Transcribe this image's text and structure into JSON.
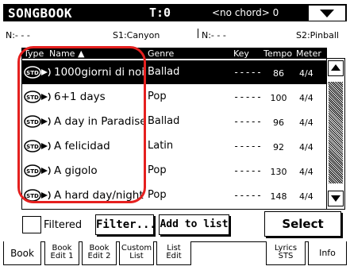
{
  "titlebar": {
    "title": "SONGBOOK",
    "tempo": "T:0",
    "chord": "<no chord> 0"
  },
  "splitrow": {
    "left_split": "N:- - -",
    "s1": "S1:Canyon",
    "mid_split": "N:- - -",
    "s2": "S2:Pinball"
  },
  "table": {
    "headers": {
      "type": "Type",
      "name": "Name ▲",
      "genre": "Genre",
      "key": "Key",
      "tempo": "Tempo",
      "meter": "Meter"
    },
    "rows": [
      {
        "name": "1000giorni di noi",
        "genre": "Ballad",
        "key": "-----",
        "tempo": "86",
        "meter": "4/4",
        "selected": true
      },
      {
        "name": "6+1 days",
        "genre": "Pop",
        "key": "-----",
        "tempo": "100",
        "meter": "4/4",
        "selected": false
      },
      {
        "name": "A day in Paradise",
        "genre": "Ballad",
        "key": "-----",
        "tempo": "96",
        "meter": "4/4",
        "selected": false
      },
      {
        "name": "A felicidad",
        "genre": "Latin",
        "key": "-----",
        "tempo": "92",
        "meter": "4/4",
        "selected": false
      },
      {
        "name": "A gigolo",
        "genre": "Pop",
        "key": "-----",
        "tempo": "130",
        "meter": "4/4",
        "selected": false
      },
      {
        "name": "A hard day/night",
        "genre": "Pop",
        "key": "-----",
        "tempo": "148",
        "meter": "4/4",
        "selected": false
      }
    ]
  },
  "controls": {
    "filtered_label": "Filtered",
    "filter_label": "Filter...",
    "add_label": "Add to list",
    "select_label": "Select"
  },
  "tabs": {
    "book": "Book",
    "book_edit1_a": "Book",
    "book_edit1_b": "Edit 1",
    "book_edit2_a": "Book",
    "book_edit2_b": "Edit 2",
    "custom_a": "Custom",
    "custom_b": "List",
    "list_a": "List",
    "list_b": "Edit",
    "lyrics_a": "Lyrics",
    "lyrics_b": "STS",
    "info": "Info"
  },
  "colors": {
    "highlight": "#e5201f",
    "foreground": "#000000",
    "background": "#ffffff"
  }
}
